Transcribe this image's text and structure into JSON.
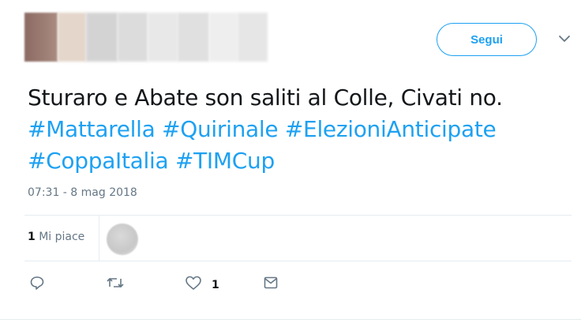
{
  "header": {
    "follow_label": "Segui",
    "colors": {
      "accent": "#1da1f2",
      "name_blur_blocks": [
        "#e2d3c6",
        "#cfcfcf",
        "#d8d8d8",
        "#e6e6e6",
        "#dedede",
        "#ececec",
        "#e4e4e4"
      ]
    }
  },
  "tweet": {
    "text_plain": "Sturaro e Abate son saliti al Colle, Civati no.",
    "hashtags_line1": [
      "#Mattarella",
      "#Quirinale",
      "#ElezioniAnticipate"
    ],
    "hashtags_line2": [
      "#CoppaItalia",
      "#TIMCup"
    ],
    "hashtag_color": "#1da1f2",
    "timestamp": "07:31 - 8 mag 2018"
  },
  "stats": {
    "likes_number": "1",
    "likes_label": "Mi piace"
  },
  "actions": {
    "reply_icon": "reply-icon",
    "retweet_icon": "retweet-icon",
    "like_icon": "heart-icon",
    "like_count": "1",
    "message_icon": "envelope-icon"
  }
}
